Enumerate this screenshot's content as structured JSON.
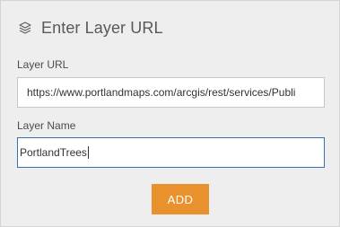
{
  "header": {
    "icon": "layers-icon",
    "title": "Enter Layer URL"
  },
  "form": {
    "layer_url": {
      "label": "Layer URL",
      "value": "https://www.portlandmaps.com/arcgis/rest/services/Publi"
    },
    "layer_name": {
      "label": "Layer Name",
      "value": "PortlandTrees"
    },
    "add_button_label": "ADD"
  },
  "colors": {
    "panel_background": "#eeeeee",
    "add_button": "#e8912d",
    "focus_border": "#3a6fb0"
  }
}
